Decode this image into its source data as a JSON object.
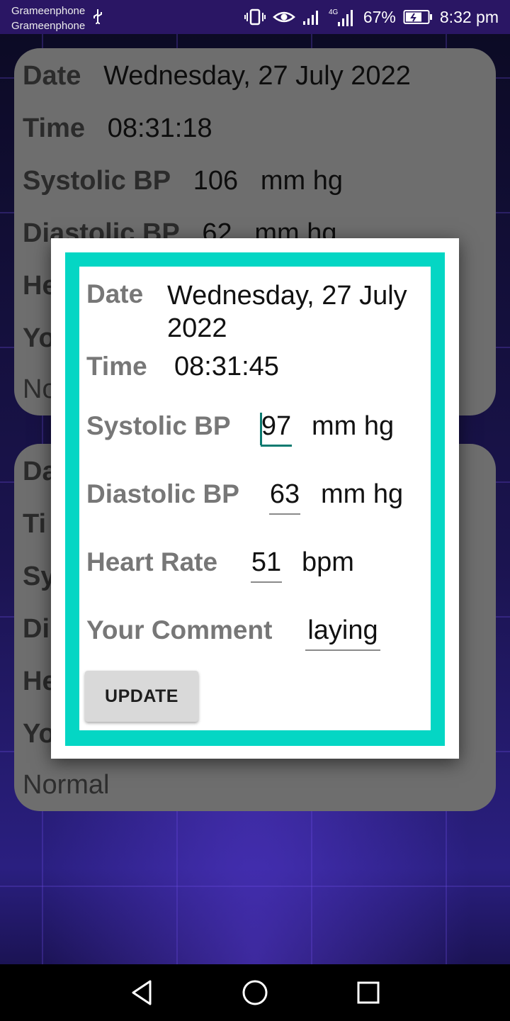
{
  "status_bar": {
    "carrier_1": "Grameenphone",
    "carrier_2": "Grameenphone",
    "network": "4G",
    "battery": "67%",
    "time": "8:32 pm"
  },
  "background_card_1": {
    "date_label": "Date",
    "date_value": "Wednesday, 27 July 2022",
    "time_label": "Time",
    "time_value": "08:31:18",
    "systolic_label": "Systolic BP",
    "systolic_value": "106",
    "systolic_unit": "mm hg",
    "diastolic_label": "Diastolic BP",
    "diastolic_value": "62",
    "diastolic_unit": "mm hg",
    "heart_partial": "He",
    "comment_partial": "Yo",
    "note_partial": "No"
  },
  "background_card_2": {
    "date_partial": "Da",
    "time_partial": "Ti",
    "systolic_partial": "Sy",
    "diastolic_partial": "Di",
    "heart_partial": "He",
    "comment_partial": "Yo",
    "note": "Normal"
  },
  "dialog": {
    "date_label": "Date",
    "date_value_line1": "Wednesday, 27 July",
    "date_value_line2": "2022",
    "time_label": "Time",
    "time_value": "08:31:45",
    "systolic_label": "Systolic BP",
    "systolic_value": "97",
    "systolic_unit": "mm hg",
    "diastolic_label": "Diastolic BP",
    "diastolic_value": "63",
    "diastolic_unit": "mm hg",
    "heart_label": "Heart Rate",
    "heart_value": "51",
    "heart_unit": "bpm",
    "comment_label": "Your Comment",
    "comment_value": "laying",
    "update_label": "UPDATE"
  },
  "colors": {
    "frame": "#04d6c4",
    "focus": "#0b7a70",
    "card": "#6e6e6e"
  }
}
